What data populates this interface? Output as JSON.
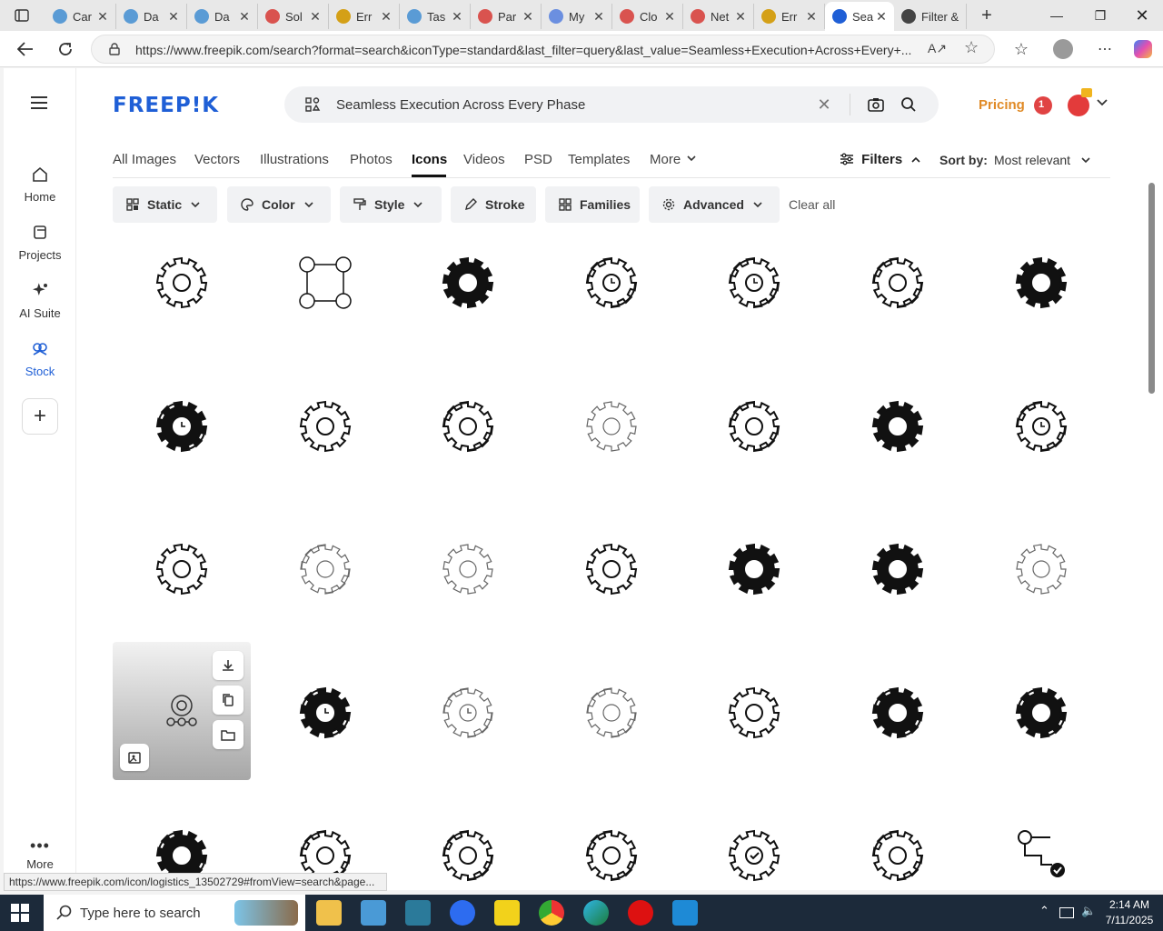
{
  "browser": {
    "tabs": [
      {
        "label": "Car",
        "color": "#5a9bd5"
      },
      {
        "label": "Da",
        "color": "#5a9bd5"
      },
      {
        "label": "Da",
        "color": "#5a9bd5"
      },
      {
        "label": "Sol",
        "color": "#d9534f"
      },
      {
        "label": "Err",
        "color": "#d4a017"
      },
      {
        "label": "Tas",
        "color": "#5a9bd5"
      },
      {
        "label": "Par",
        "color": "#d9534f"
      },
      {
        "label": "My",
        "color": "#6b8fe0"
      },
      {
        "label": "Clo",
        "color": "#d9534f"
      },
      {
        "label": "Net",
        "color": "#d9534f"
      },
      {
        "label": "Err",
        "color": "#d4a017"
      },
      {
        "label": "Sea",
        "color": "#1f5fd6"
      },
      {
        "label": "Filter &",
        "color": "#444444"
      }
    ],
    "url": "https://www.freepik.com/search?format=search&iconType=standard&last_filter=query&last_value=Seamless+Execution+Across+Every+..."
  },
  "nav": {
    "items": [
      {
        "label": "Home"
      },
      {
        "label": "Projects"
      },
      {
        "label": "AI Suite"
      },
      {
        "label": "Stock"
      }
    ],
    "more": "More"
  },
  "header": {
    "logo": "FREEP!K",
    "search_query": "Seamless Execution Across Every Phase",
    "pricing": "Pricing",
    "notifications": "1"
  },
  "categories": {
    "items": [
      "All Images",
      "Vectors",
      "Illustrations",
      "Photos",
      "Icons",
      "Videos",
      "PSD",
      "Templates",
      "More"
    ],
    "active": "Icons",
    "filters": "Filters",
    "sort_label": "Sort by:",
    "sort_value": "Most relevant"
  },
  "chips": [
    "Static",
    "Color",
    "Style",
    "Stroke",
    "Families",
    "Advanced"
  ],
  "clear_all": "Clear all",
  "results": {
    "icons": [
      "gear-network-icon",
      "process-nodes-icon",
      "circular-gear-icon",
      "gear-clock-icon",
      "gear-clock-icon",
      "gear-cycle-icon",
      "solid-gear-ring-icon",
      "gear-clock-icon",
      "concentric-gear-icon",
      "gear-cycle-icon",
      "gear-group-icon",
      "gear-cycle-icon",
      "gear-hourglass-icon",
      "gear-clock-icon",
      "gear-dots-icon",
      "gear-cycle-icon",
      "gear-nodes-icon",
      "gear-arrow-icon",
      "gear-search-icon",
      "gear-hourglass-icon",
      "gear-group-icon",
      "gear-workflow-icon",
      "gear-clock-icon",
      "gear-clock-icon",
      "gear-cycle-icon",
      "gear-group-icon",
      "gear-cycle-icon",
      "gear-cycle-icon",
      "gear-cycle-icon",
      "gear-cycle-icon",
      "gear-cycle-icon",
      "gear-cycle-icon",
      "gear-check-icon",
      "gear-cycle-icon",
      "flowchart-check-icon"
    ]
  },
  "status_url": "https://www.freepik.com/icon/logistics_13502729#fromView=search&page...",
  "taskbar": {
    "search_placeholder": "Type here to search",
    "time": "2:14 AM",
    "date": "7/11/2025"
  }
}
